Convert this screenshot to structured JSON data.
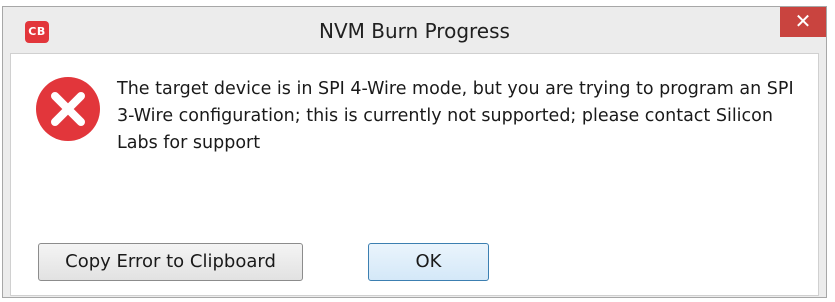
{
  "window": {
    "title": "NVM Burn Progress",
    "app_icon_label": "CB",
    "close_glyph": "✕"
  },
  "dialog": {
    "icon": "error-icon",
    "message": "The target device is in SPI 4-Wire mode, but you are trying to program an SPI 3-Wire configuration; this is currently not supported; please contact Silicon Labs for support"
  },
  "buttons": {
    "copy_label": "Copy Error to Clipboard",
    "ok_label": "OK"
  },
  "colors": {
    "error_red": "#e2363b",
    "close_red": "#c9443f",
    "window_bg": "#ececec"
  }
}
